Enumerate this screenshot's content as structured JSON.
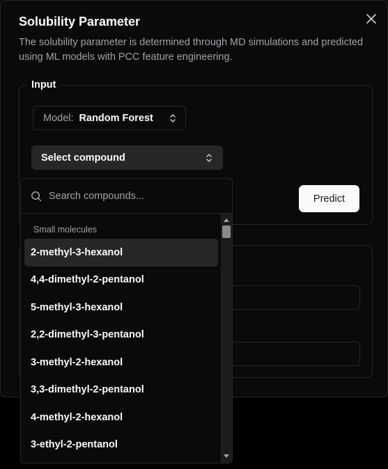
{
  "dialog": {
    "title": "Solubility Parameter",
    "description": "The solubility parameter is determined through MD simulations and predicted using ML models with PCC feature engineering."
  },
  "input_section": {
    "legend": "Input",
    "model_label": "Model:",
    "model_value": "Random Forest",
    "compound_value": "Select compound",
    "predict_label": "Predict"
  },
  "dropdown": {
    "search_placeholder": "Search compounds...",
    "group_label": "Small molecules",
    "options": [
      "2-methyl-3-hexanol",
      "4,4-dimethyl-2-pentanol",
      "5-methyl-3-hexanol",
      "2,2-dimethyl-3-pentanol",
      "3-methyl-2-hexanol",
      "3,3-dimethyl-2-pentanol",
      "4-methyl-2-hexanol",
      "3-ethyl-2-pentanol"
    ],
    "highlighted_index": 0
  },
  "icons": {
    "close": "close-icon",
    "chevrons": "chevron-up-down-icon",
    "search": "search-icon"
  },
  "colors": {
    "background": "#0a0a0a",
    "border": "#27272a",
    "text": "#fafafa",
    "muted": "#a1a1aa",
    "button_bg": "#fafafa"
  }
}
